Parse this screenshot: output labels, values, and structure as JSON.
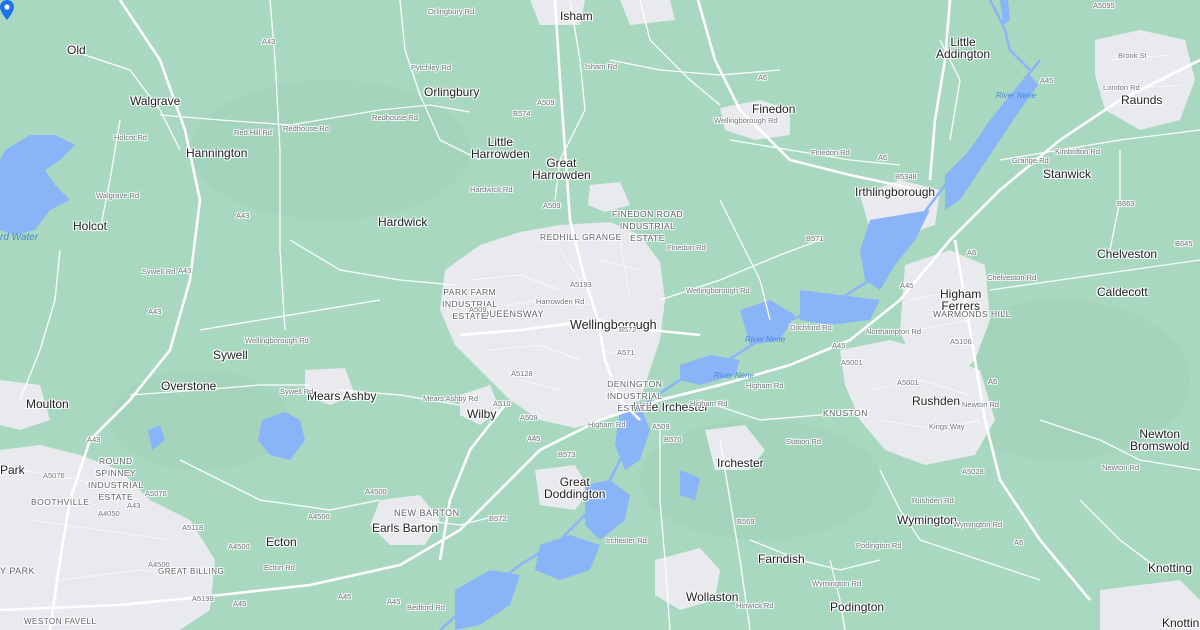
{
  "map": {
    "colors": {
      "land": "#a9d8c0",
      "urban": "#e8eaed",
      "water": "#8ab4f8",
      "road": "#ffffff",
      "pin": "#1a73e8"
    },
    "marker_location": "Wellingborough",
    "places": {
      "isham": "Isham",
      "old": "Old",
      "little_addington": "Little\nAddington",
      "walgrave": "Walgrave",
      "orlingbury": "Orlingbury",
      "finedon": "Finedon",
      "raunds": "Raunds",
      "hannington": "Hannington",
      "little_harrowden": "Little\nHarrowden",
      "great_harrowden": "Great\nHarrowden",
      "irthlingborough": "Irthlingborough",
      "stanwick": "Stanwick",
      "holcot": "Holcot",
      "hardwick": "Hardwick",
      "chelveston": "Chelveston",
      "higham_ferrers": "Higham\nFerrers",
      "caldecott": "Caldecott",
      "queensway": "QUEENSWAY",
      "wellingborough": "Wellingborough",
      "sywell": "Sywell",
      "overstone": "Overstone",
      "mears_ashby": "Mears Ashby",
      "moulton": "Moulton",
      "wilby": "Wilby",
      "little_irchester": "Little Irchester",
      "rushden": "Rushden",
      "newton_bromswold": "Newton\nBromswold",
      "irchester": "Irchester",
      "park": "Park",
      "great_doddington": "Great\nDoddington",
      "new_barton": "NEW BARTON",
      "earls_barton": "Earls Barton",
      "ecton": "Ecton",
      "farndish": "Farndish",
      "wymington": "Wymington",
      "y_park": "Y PARK",
      "great_billing": "GREAT BILLING",
      "weston_favell": "WESTON FAVELL",
      "wollaston": "Wollaston",
      "podington": "Podington",
      "knotting": "Knotting",
      "knotting_green": "Knotting"
    },
    "areas": {
      "finedon_road": "FINEDON ROAD\nINDUSTRIAL\nESTATE",
      "redhill_grange": "REDHILL GRANGE",
      "park_farm": "PARK FARM\nINDUSTRIAL\nESTATE",
      "denington": "DENINGTON\nINDUSTRIAL\nESTATE",
      "warmonds_hill": "WARMONDS HILL",
      "knuston": "KNUSTON",
      "round_spinney": "ROUND\nSPINNEY\nINDUSTRIAL\nESTATE",
      "boothville": "BOOTHVILLE"
    },
    "roads": {
      "a43_n": "A43",
      "a43_mid": "A43",
      "a43_s": "A43",
      "a43_sw": "A43",
      "a43_w": "A43",
      "a509_n": "A509",
      "a509_s": "A509",
      "a509_sw": "A509",
      "a509_se": "A509",
      "b574": "B574",
      "a6_n": "A6",
      "a6_mid": "A6",
      "a6_e": "A6",
      "a6_s": "A6",
      "a6_se": "A6",
      "b5348": "B5348",
      "a5193": "A5193",
      "a5128": "A5128",
      "a510": "A510",
      "a510_w": "A510",
      "a5001": "A5001",
      "a5001_e": "A5001",
      "b570": "B570",
      "b571": "B571",
      "a5076": "A5076",
      "b572": "B572",
      "b573": "B573",
      "b569": "B569",
      "a4500": "A4500",
      "a4500_w": "A4500",
      "a45_a": "A45",
      "a45_b": "A45",
      "a45_c": "A45",
      "a45_d": "A45",
      "a45_e": "A45",
      "a45_f": "A45",
      "a5095": "A5095",
      "b645": "B645",
      "b663": "B663",
      "a5028": "A5028",
      "a5118": "A5118",
      "a4050": "A4050",
      "a5106": "A5106",
      "a5199": "A5199",
      "a571": "A571",
      "redhill_rd": "Redhouse Rd",
      "red_hill_rd": "Red Hill Rd",
      "holcot_rd": "Holcot Rd",
      "walgrave_rd": "Walgrave Rd",
      "sywell_rd": "Sywell Rd",
      "mears_ashby_rd": "Mears Ashby Rd",
      "wellingborough_rd": "Wellingborough Rd",
      "finedon_rd": "Finedon Rd",
      "harrowden_rd": "Harrowden Rd",
      "pytchley_rd": "Pytchley Rd",
      "orlingbury_rd": "Orlingbury Rd",
      "isham_rd": "Isham Rd",
      "higham_rd": "Higham Rd",
      "newton_rd": "Newton Rd",
      "rushden_rd": "Rushden Rd",
      "chelveston_rd": "Chelveston Rd",
      "station_rd": "Station Rd",
      "irchester_rd": "Irchester Rd",
      "hinwick_rd": "Hinwick Rd",
      "wymington_rd": "Wymington Rd",
      "podington_rd": "Podington Rd",
      "bedford_rd": "Bedford Rd",
      "ecton_rd": "Ecton Rd",
      "hardwick_rd": "Hardwick Rd",
      "brook_st": "Brook St",
      "london_rd": "London Rd",
      "kimbolton_rd": "Kimbolton Rd",
      "grange_rd": "Grange Rd",
      "ditchford_rd": "Ditchford Rd",
      "northampton_rd": "Northampton Rd",
      "kings_way": "Kings Way",
      "ruspenuk_rd": "Newton Rd"
    },
    "water": {
      "river_nene_ne": "River Nene",
      "river_nene_c": "River Nene",
      "river_nene_s": "River Nene",
      "reservoir": "rd Water"
    }
  }
}
